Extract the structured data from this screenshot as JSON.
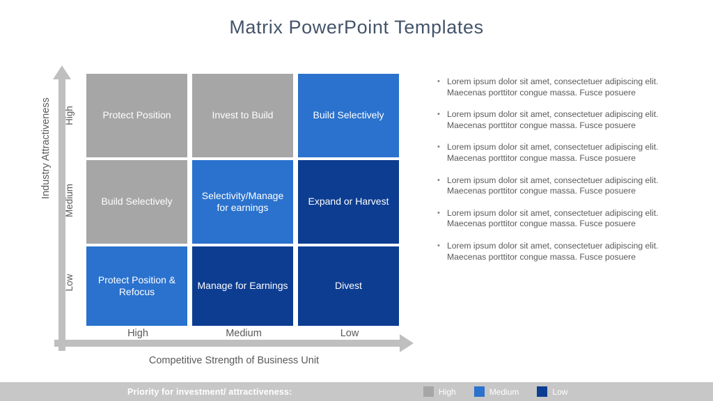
{
  "slide": {
    "title": "Matrix PowerPoint Templates",
    "title_color": "#44546a",
    "background": "#ffffff"
  },
  "matrix": {
    "y_axis": {
      "label": "Industry Attractiveness",
      "ticks": [
        "High",
        "Medium",
        "Low"
      ]
    },
    "x_axis": {
      "label": "Competitive Strength of Business Unit",
      "ticks": [
        "High",
        "Medium",
        "Low"
      ]
    },
    "cells": [
      {
        "text": "Protect Position",
        "color": "#a6a6a6",
        "row": "High",
        "col": "High"
      },
      {
        "text": "Invest to Build",
        "color": "#a6a6a6",
        "row": "High",
        "col": "Medium"
      },
      {
        "text": "Build Selectively",
        "color": "#2a72cd",
        "row": "High",
        "col": "Low"
      },
      {
        "text": "Build Selectively",
        "color": "#a6a6a6",
        "row": "Medium",
        "col": "High"
      },
      {
        "text": "Selectivity/Manage for earnings",
        "color": "#2a72cd",
        "row": "Medium",
        "col": "Medium"
      },
      {
        "text": "Expand or Harvest",
        "color": "#0c3d91",
        "row": "Medium",
        "col": "Low"
      },
      {
        "text": "Protect Position & Refocus",
        "color": "#2a72cd",
        "row": "Low",
        "col": "High"
      },
      {
        "text": "Manage for Earnings",
        "color": "#0c3d91",
        "row": "Low",
        "col": "Medium"
      },
      {
        "text": "Divest",
        "color": "#0c3d91",
        "row": "Low",
        "col": "Low"
      }
    ]
  },
  "bullets": [
    {
      "text": "Lorem ipsum dolor sit amet, consectetuer adipiscing elit. Maecenas porttitor congue massa. Fusce posuere"
    },
    {
      "text": "Lorem ipsum dolor sit amet, consectetuer adipiscing elit. Maecenas porttitor congue massa. Fusce posuere"
    },
    {
      "text": "Lorem ipsum dolor sit amet, consectetuer adipiscing elit. Maecenas porttitor congue massa. Fusce posuere"
    },
    {
      "text": "Lorem ipsum dolor sit amet, consectetuer adipiscing elit. Maecenas porttitor congue massa. Fusce posuere"
    },
    {
      "text": "Lorem ipsum dolor sit amet, consectetuer adipiscing elit. Maecenas porttitor congue massa. Fusce posuere"
    },
    {
      "text": "Lorem ipsum dolor sit amet, consectetuer adipiscing elit. Maecenas porttitor congue massa. Fusce posuere"
    }
  ],
  "footer": {
    "caption": "Priority  for investment/  attractiveness:",
    "bar_color": "#c7c7c7",
    "legend": [
      {
        "label": "High",
        "color": "#a6a6a6"
      },
      {
        "label": "Medium",
        "color": "#2a72cd"
      },
      {
        "label": "Low",
        "color": "#0c3d91"
      }
    ]
  },
  "chart_data": {
    "type": "heatmap",
    "title": "Matrix PowerPoint Templates",
    "xlabel": "Competitive Strength of Business Unit",
    "ylabel": "Industry Attractiveness",
    "x_categories": [
      "High",
      "Medium",
      "Low"
    ],
    "y_categories": [
      "High",
      "Medium",
      "Low"
    ],
    "cell_labels": [
      [
        "Protect Position",
        "Invest to Build",
        "Build Selectively"
      ],
      [
        "Build Selectively",
        "Selectivity/Manage for earnings",
        "Expand or Harvest"
      ],
      [
        "Protect Position & Refocus",
        "Manage for Earnings",
        "Divest"
      ]
    ],
    "cell_priority": [
      [
        "High",
        "High",
        "Medium"
      ],
      [
        "High",
        "Medium",
        "Low"
      ],
      [
        "Medium",
        "Low",
        "Low"
      ]
    ],
    "legend_position": "footer",
    "grid": false
  }
}
